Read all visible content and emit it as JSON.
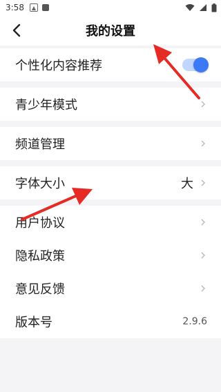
{
  "status_bar": {
    "time": "3:58"
  },
  "nav": {
    "title": "我的设置"
  },
  "settings": {
    "personalized_recommend": {
      "label": "个性化内容推荐",
      "enabled": true
    },
    "youth_mode": {
      "label": "青少年模式"
    },
    "channel_manage": {
      "label": "频道管理"
    },
    "font_size": {
      "label": "字体大小",
      "value": "大"
    },
    "user_agreement": {
      "label": "用户协议"
    },
    "privacy_policy": {
      "label": "隐私政策"
    },
    "feedback": {
      "label": "意见反馈"
    },
    "version": {
      "label": "版本号",
      "value": "2.9.6"
    }
  },
  "colors": {
    "accent": "#3b79f6",
    "annotation_arrow": "#e52b24",
    "background": "#f4f4f6"
  },
  "icons": {
    "back": "back-arrow-icon",
    "chevron": "chevron-right-icon"
  }
}
